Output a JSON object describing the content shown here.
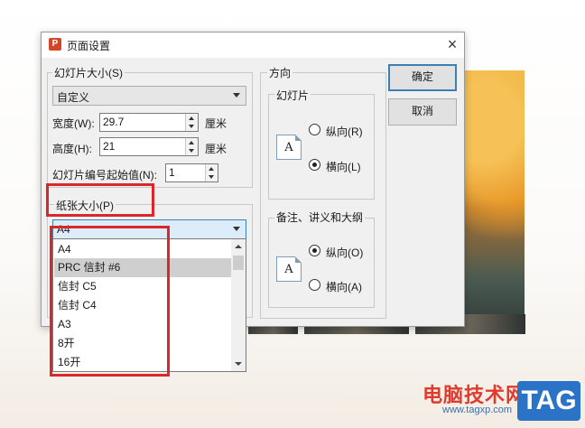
{
  "dialog": {
    "title": "页面设置",
    "app_icon": "P",
    "close": "×",
    "slide_size": {
      "legend": "幻灯片大小(S)",
      "preset": "自定义",
      "width_label": "宽度(W):",
      "width_value": "29.7",
      "height_label": "高度(H):",
      "height_value": "21",
      "unit": "厘米",
      "start_number_label": "幻灯片编号起始值(N):",
      "start_number_value": "1"
    },
    "paper_size": {
      "legend": "纸张大小(P)",
      "selected": "A4",
      "options": [
        "A4",
        "PRC 信封 #6",
        "信封 C5",
        "信封 C4",
        "A3",
        "8开",
        "16开"
      ],
      "highlighted_index": 1
    },
    "orientation": {
      "legend": "方向",
      "slides": {
        "legend": "幻灯片",
        "portrait": "纵向(R)",
        "landscape": "横向(L)",
        "selected": "landscape"
      },
      "notes": {
        "legend": "备注、讲义和大纲",
        "portrait": "纵向(O)",
        "landscape": "横向(A)",
        "selected": "portrait"
      },
      "page_icon_letter": "A"
    },
    "buttons": {
      "ok": "确定",
      "cancel": "取消"
    }
  },
  "watermark": {
    "text": "电脑技术网",
    "url": "www.tagxp.com",
    "logo": "TAG"
  },
  "colors": {
    "highlight_red": "#d8282c",
    "primary_border": "#3c7fb1",
    "logo_blue": "#2a73c6"
  }
}
